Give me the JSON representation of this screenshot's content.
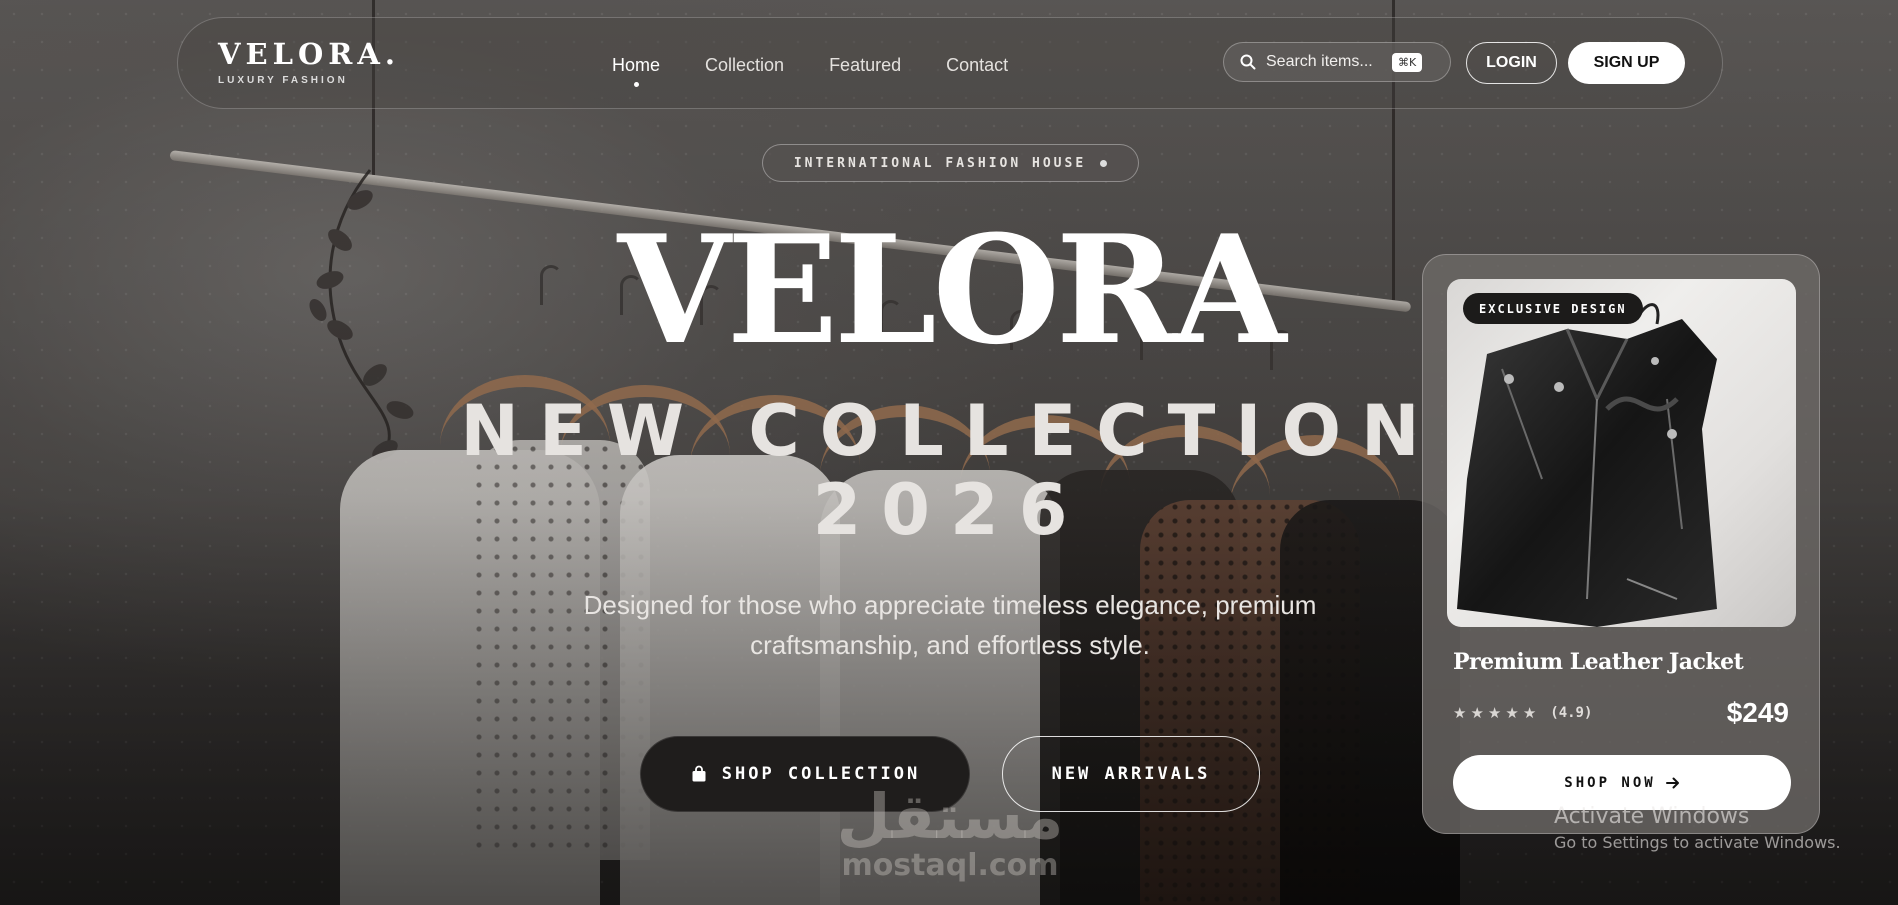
{
  "nav": {
    "brand": "VELORA.",
    "tagline": "LUXURY FASHION",
    "links": [
      {
        "label": "Home",
        "active": true
      },
      {
        "label": "Collection"
      },
      {
        "label": "Featured"
      },
      {
        "label": "Contact"
      }
    ],
    "search_placeholder": "Search items...",
    "search_shortcut": "⌘K",
    "login_label": "LOGIN",
    "signup_label": "SIGN UP"
  },
  "hero": {
    "badge": "INTERNATIONAL FASHION HOUSE",
    "brand": "VELORA",
    "headline_line1": "NEW COLLECTION",
    "headline_line2": "2026",
    "description": "Designed for those who appreciate timeless elegance, premium craftsmanship, and effortless style.",
    "primary_cta": "SHOP COLLECTION",
    "secondary_cta": "NEW ARRIVALS"
  },
  "product_card": {
    "tag": "EXCLUSIVE DESIGN",
    "title": "Premium Leather Jacket",
    "rating_stars": 5,
    "rating_text": "(4.9)",
    "price": "$249",
    "cta": "SHOP NOW"
  },
  "watermark": {
    "arabic": "مستقل",
    "latin": "mostaql.com"
  },
  "system_overlay": {
    "title": "Activate Windows",
    "subtitle": "Go to Settings to activate Windows."
  },
  "icons": {
    "search": "search-icon",
    "bag": "shopping-bag-icon",
    "arrow": "arrow-right-icon",
    "star": "star-icon"
  },
  "colors": {
    "primary_dark": "#1f1d1c",
    "accent_light": "#ffffff",
    "card_bg": "#6e6a68"
  }
}
